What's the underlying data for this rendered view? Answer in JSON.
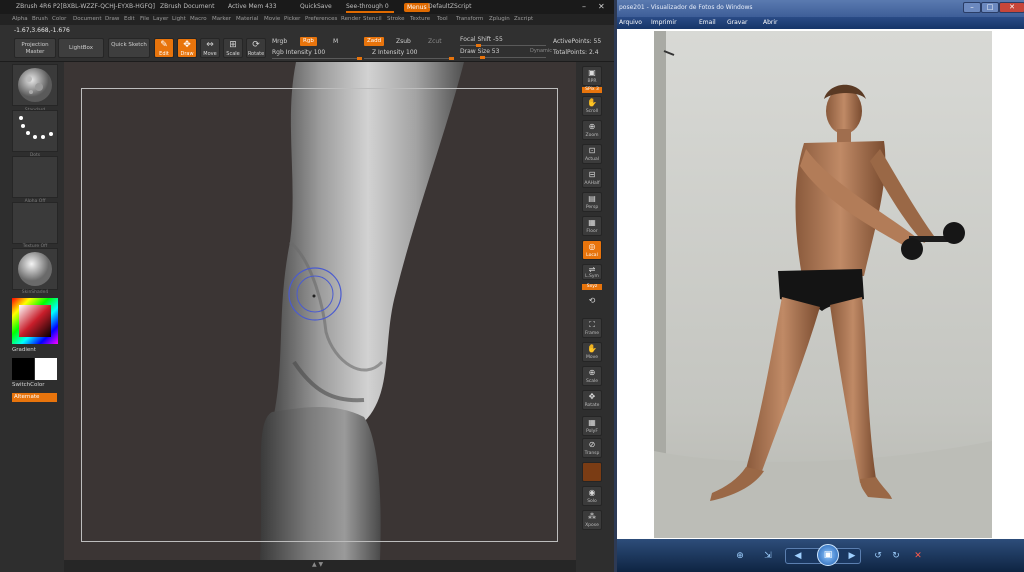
{
  "zbrush": {
    "title_items": [
      "ZBrush 4R6 P2[BXBL-WZZF-QCHJ-EYXB-HGFQ]",
      "ZBrush Document",
      "Active Mem 433",
      "QuickSave",
      "See-through 0",
      "Menus",
      "DefaultZScript"
    ],
    "menu_items": [
      "Alpha",
      "Brush",
      "Color",
      "Document",
      "Draw",
      "Edit",
      "File",
      "Layer",
      "Light",
      "Macro",
      "Marker",
      "Material",
      "Movie",
      "Picker",
      "Preferences",
      "Render",
      "Stencil",
      "Stroke",
      "Texture",
      "Tool",
      "Transform",
      "Zplugin",
      "Zscript"
    ],
    "coords": "-1.67,3.668,-1.676",
    "toolbar": {
      "projection_master": "Projection Master",
      "lightbox": "LightBox",
      "quick_sketch": "Quick Sketch",
      "edit": "Edit",
      "draw": "Draw",
      "move": "Move",
      "scale": "Scale",
      "rotate": "Rotate",
      "mrgb": "Mrgb",
      "rgb": "Rgb",
      "m": "M",
      "rgb_intensity": "Rgb Intensity 100",
      "zadd": "Zadd",
      "zsub": "Zsub",
      "zcut": "Zcut",
      "z_intensity": "Z Intensity 100",
      "focal_shift": "Focal Shift -55",
      "draw_size": "Draw Size 53",
      "dynamic": "Dynamic",
      "active_points": "ActivePoints: 55",
      "total_points": "TotalPoints: 2.4"
    },
    "left_palette": {
      "slot_labels": [
        "Standard",
        "Dots",
        "Alpha Off",
        "Texture Off",
        "SkinShade4"
      ],
      "gradient": "Gradient",
      "switch_color": "SwitchColor",
      "alternate": "Alternate"
    },
    "right_shelf": {
      "buttons": [
        "BPR",
        "SPix 3",
        "Scroll",
        "Zoom",
        "Actual",
        "AAHalf",
        "Persp",
        "Floor",
        "Local",
        "L.Sym",
        "Sxyz",
        "Frame",
        "Move",
        "Scale",
        "Rotate",
        "PolyF",
        "Transp",
        "Solo",
        "Xpose"
      ]
    },
    "colors": {
      "accent": "#e8740c",
      "canvas": "#3b3534"
    }
  },
  "photo_viewer": {
    "title": "pose201 - Visualizador de Fotos do Windows",
    "menu": [
      "Arquivo",
      "Imprimir",
      "Email",
      "Gravar",
      "Abrir"
    ],
    "controls": [
      "zoom-icon",
      "fit-icon",
      "previous-icon",
      "slideshow-icon",
      "next-icon",
      "rotate-left-icon",
      "rotate-right-icon",
      "delete-icon"
    ]
  }
}
